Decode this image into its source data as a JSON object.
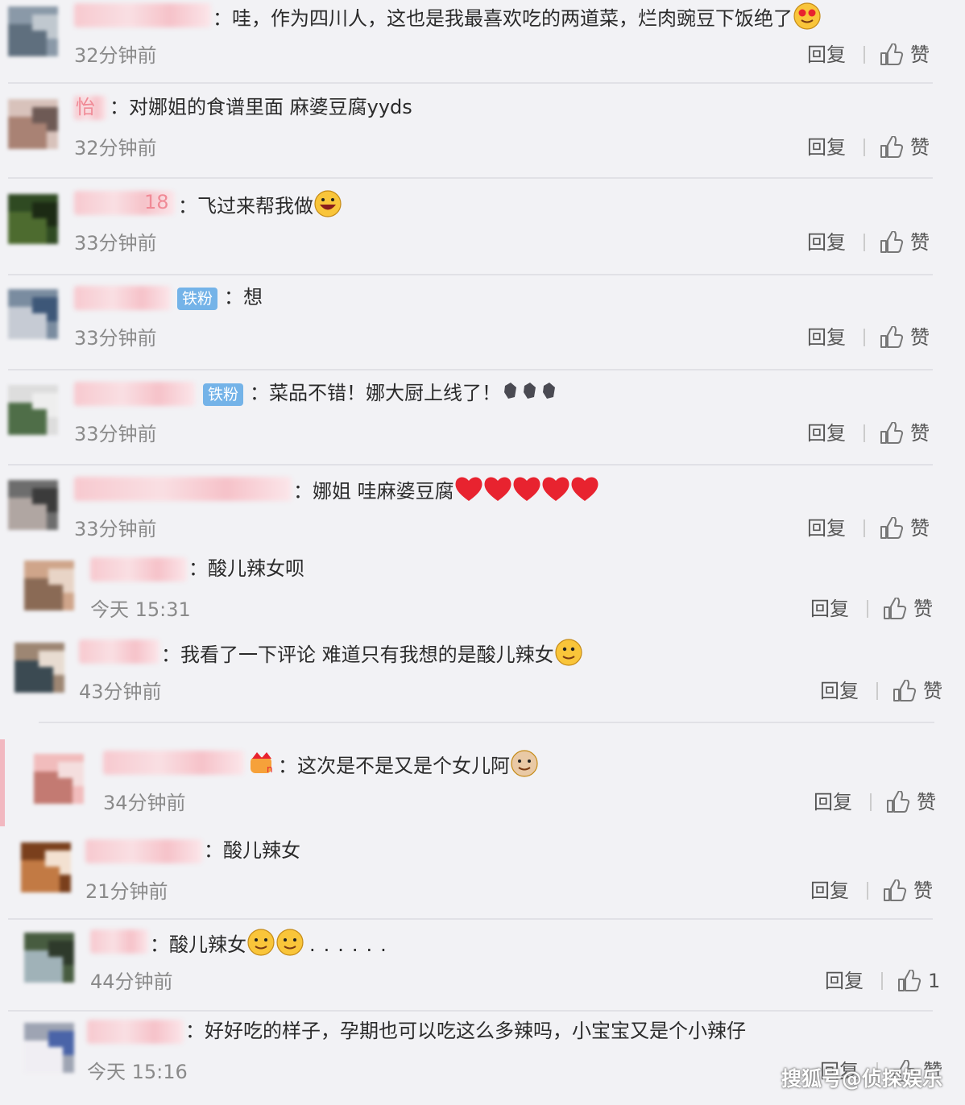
{
  "actions": {
    "reply_label": "回复",
    "like_label": "赞"
  },
  "badges": {
    "iron_fan": "铁粉"
  },
  "comments": [
    {
      "name_fragment": "",
      "text": "：哇，作为四川人，这也是我最喜欢吃的两道菜，烂肉豌豆下饭绝了",
      "emoji": "heart-eyes-emoji",
      "time": "32分钟前",
      "likes": ""
    },
    {
      "name_fragment": "怡",
      "text": "：对娜姐的食谱里面 麻婆豆腐yyds",
      "emoji": "",
      "time": "32分钟前",
      "likes": ""
    },
    {
      "name_fragment": "18",
      "text": "：飞过来帮我做",
      "emoji": "laughing-emoji",
      "time": "33分钟前",
      "likes": ""
    },
    {
      "name_fragment": "",
      "text": "：想",
      "emoji": "",
      "time": "33分钟前",
      "likes": ""
    },
    {
      "name_fragment": "",
      "text": "：菜品不错！娜大厨上线了！",
      "emoji": "clapping-hands-emoji",
      "time": "33分钟前",
      "likes": ""
    },
    {
      "name_fragment": "",
      "text": "：娜姐 哇麻婆豆腐",
      "emoji": "red-hearts-emoji",
      "time": "33分钟前",
      "likes": ""
    },
    {
      "name_fragment": "",
      "text": "：酸儿辣女呗",
      "emoji": "",
      "time": "今天 15:31",
      "likes": ""
    },
    {
      "name_fragment": "",
      "text": "：我看了一下评论 难道只有我想的是酸儿辣女",
      "emoji": "thinking-emoji",
      "time": "43分钟前",
      "likes": ""
    },
    {
      "name_fragment": "",
      "text": "：这次是不是又是个女儿阿",
      "emoji": "cat-emoji",
      "time": "34分钟前",
      "likes": ""
    },
    {
      "name_fragment": "",
      "text": "：酸儿辣女",
      "emoji": "",
      "time": "21分钟前",
      "likes": ""
    },
    {
      "name_fragment": "",
      "text": "：酸儿辣女",
      "emoji": "smile-emoji",
      "trail": "......",
      "time": "44分钟前",
      "likes": "1"
    },
    {
      "name_fragment": "",
      "text": "：好好吃的样子，孕期也可以吃这么多辣吗，小宝宝又是个小辣仔",
      "emoji": "",
      "time": "今天 15:16",
      "likes": ""
    }
  ],
  "watermark": "搜狐号@侦探娱乐",
  "colors": {
    "badge": "#74b3e8",
    "name_accent": "#f08a96",
    "background": "#f2f2f5"
  }
}
